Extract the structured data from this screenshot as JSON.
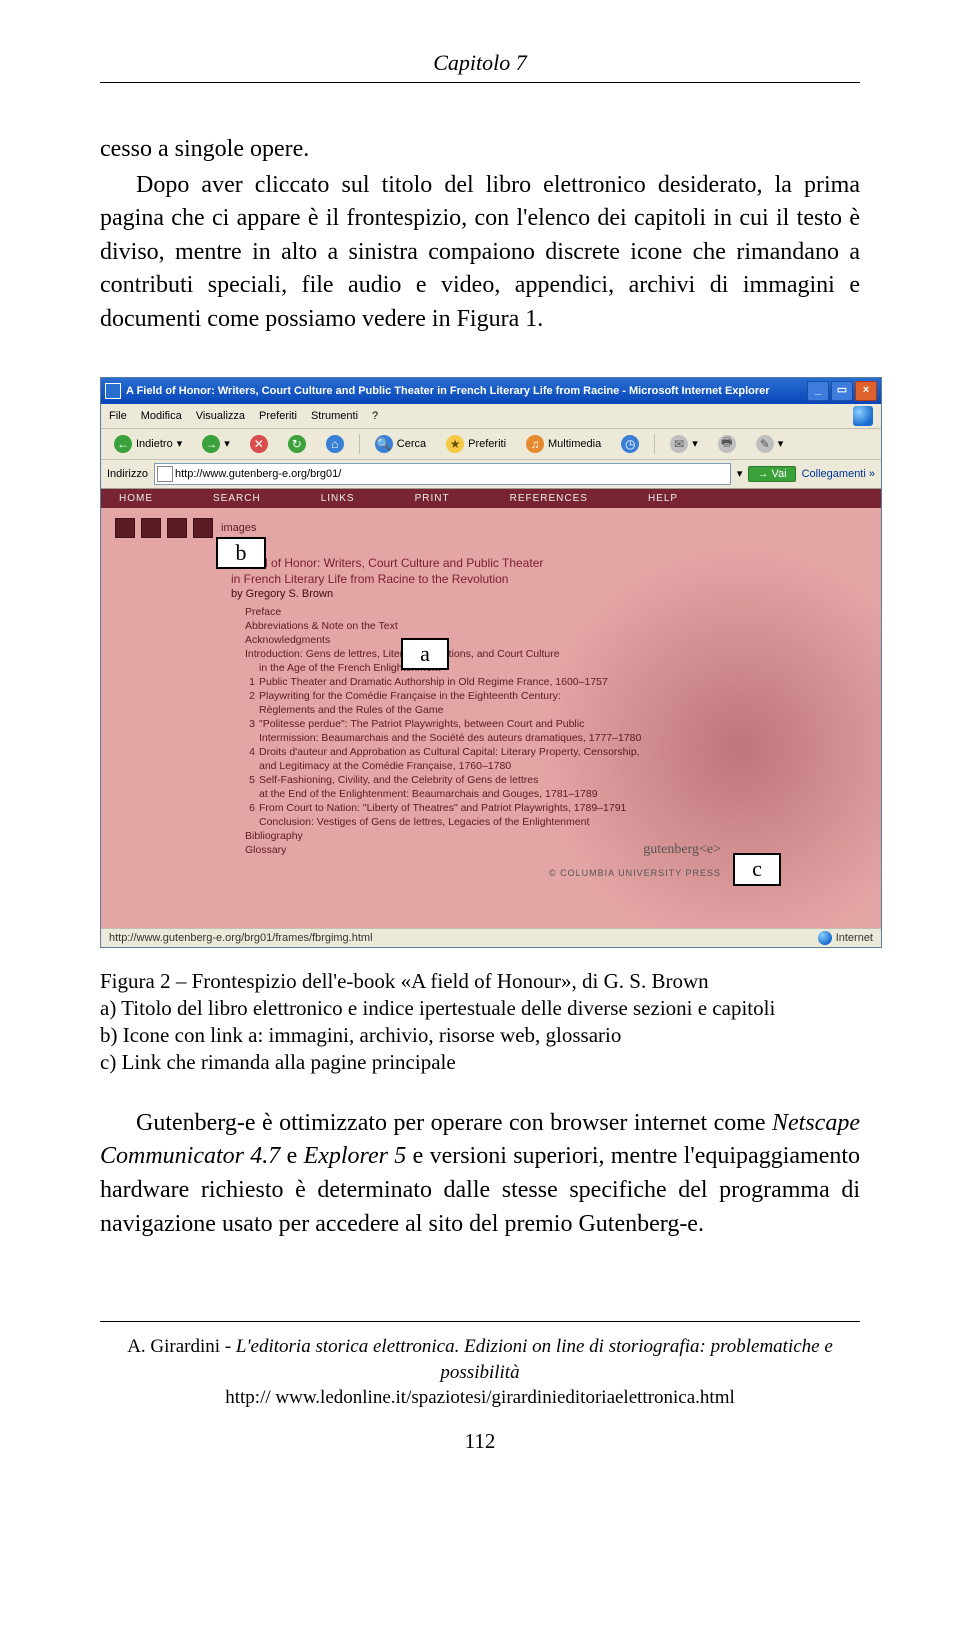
{
  "chapter": "Capitolo 7",
  "para1": "cesso a singole opere.",
  "para2": "Dopo aver cliccato sul titolo del libro elettronico desiderato, la prima pagina che ci appare è il frontespizio, con l'elenco dei capitoli in cui il testo è diviso, mentre in alto a sinistra compaiono discrete icone che rimandano a contributi speciali, file audio e video, appendici, archivi di immagini e documenti come possiamo vedere in Figura 1.",
  "browser": {
    "title": "A Field of Honor: Writers, Court Culture and Public Theater in French Literary Life from Racine - Microsoft Internet Explorer",
    "menus": [
      "File",
      "Modifica",
      "Visualizza",
      "Preferiti",
      "Strumenti",
      "?"
    ],
    "toolbar": {
      "back": "Indietro",
      "search": "Cerca",
      "favorites": "Preferiti",
      "multimedia": "Multimedia"
    },
    "addr_label": "Indirizzo",
    "url": "http://www.gutenberg-e.org/brg01/",
    "go": "Vai",
    "links": "Collegamenti",
    "nav": [
      "HOME",
      "SEARCH",
      "LINKS",
      "PRINT",
      "REFERENCES",
      "HELP"
    ],
    "images_label": "images",
    "book": {
      "title": "A Field of Honor: Writers, Court Culture and Public Theater",
      "subtitle": "in French Literary Life from Racine to the Revolution",
      "by": "by Gregory S. Brown",
      "front": [
        "Preface",
        "Abbreviations & Note on the Text",
        "Acknowledgments"
      ],
      "intro_a": "Introduction: Gens de lettres, Literary Institutions, and Court Culture",
      "intro_b": "in the Age of the French Enlightenment",
      "chapters": [
        {
          "n": "1",
          "t": "Public Theater and Dramatic Authorship in Old Regime France, 1600–1757"
        },
        {
          "n": "2",
          "t": "Playwriting for the Comédie Française in the Eighteenth Century:",
          "s": "Règlements and the Rules of the Game"
        },
        {
          "n": "3",
          "t": "\"Politesse perdue\": The Patriot Playwrights, between Court and Public",
          "s": "Intermission: Beaumarchais and the Société des auteurs dramatiques, 1777–1780"
        },
        {
          "n": "4",
          "t": "Droits d'auteur and Approbation as Cultural Capital: Literary Property, Censorship,",
          "s": "and Legitimacy at the Comédie Française, 1760–1780"
        },
        {
          "n": "5",
          "t": "Self-Fashioning, Civility, and the Celebrity of Gens de lettres",
          "s": "at the End of the Enlightenment: Beaumarchais and Gouges, 1781–1789"
        },
        {
          "n": "6",
          "t": "From Court to Nation: \"Liberty of Theatres\" and Patriot Playwrights, 1789–1791",
          "s": "Conclusion: Vestiges of Gens de lettres, Legacies of the Enlightenment"
        }
      ],
      "back": [
        "Bibliography",
        "Glossary"
      ],
      "brand": "gutenberg<e>",
      "press": "© COLUMBIA UNIVERSITY PRESS"
    },
    "status_url": "http://www.gutenberg-e.org/brg01/frames/fbrgimg.html",
    "zone": "Internet"
  },
  "annot": {
    "a": "a",
    "b": "b",
    "c": "c"
  },
  "caption": {
    "l1": "Figura 2 – Frontespizio dell'e-book «A field of Honour», di G. S. Brown",
    "l2": "a) Titolo del libro elettronico e indice ipertestuale delle diverse sezioni e capitoli",
    "l3": "b) Icone con link a: immagini, archivio, risorse web, glossario",
    "l4": "c) Link che rimanda alla pagine principale"
  },
  "para3_a": "Gutenberg-e è ottimizzato per operare con browser internet come ",
  "para3_i1": "Netscape Communicator 4.7",
  "para3_b": " e ",
  "para3_i2": "Explorer 5",
  "para3_c": " e versioni superiori, mentre l'equipaggiamento hardware richiesto è determinato dalle stesse specifiche del programma di navigazione usato per accedere al sito del premio Gutenberg-e.",
  "footer": {
    "l1a": "A. Girardini - ",
    "l1b": "L'editoria storica elettronica. Edizioni on line di storiografia: problematiche e possibilità",
    "l2": "http:// www.ledonline.it/spaziotesi/girardinieditoriaelettronica.html"
  },
  "pagenum": "112"
}
